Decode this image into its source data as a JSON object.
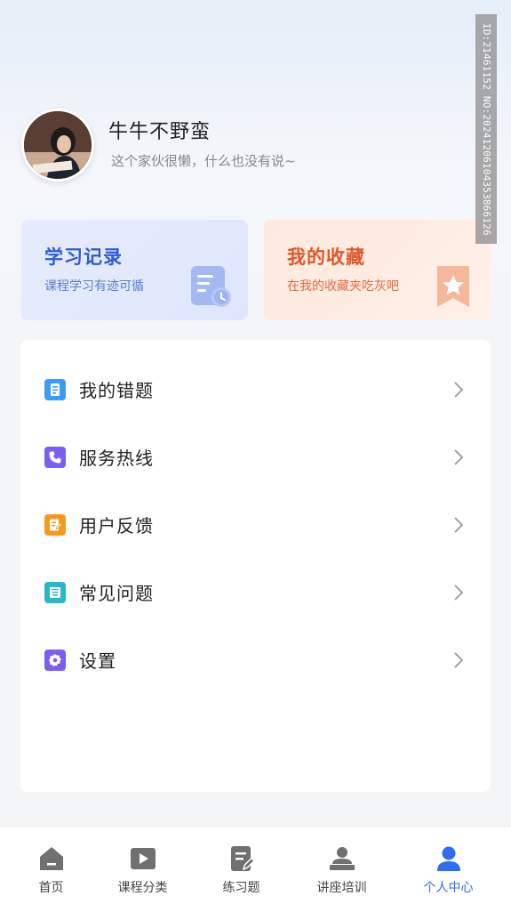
{
  "profile": {
    "username": "牛牛不野蛮",
    "bio": "这个家伙很懒，什么也没有说~"
  },
  "cards": {
    "study": {
      "title": "学习记录",
      "subtitle": "课程学习有迹可循"
    },
    "favorites": {
      "title": "我的收藏",
      "subtitle": "在我的收藏夹吃灰吧"
    }
  },
  "menu": [
    {
      "label": "我的错题",
      "icon": "wrong-questions-icon",
      "color": "#3a9cf5"
    },
    {
      "label": "服务热线",
      "icon": "phone-icon",
      "color": "#7b5ff2"
    },
    {
      "label": "用户反馈",
      "icon": "feedback-icon",
      "color": "#f59a1e"
    },
    {
      "label": "常见问题",
      "icon": "faq-icon",
      "color": "#29b8c9"
    },
    {
      "label": "设置",
      "icon": "gear-icon",
      "color": "#7b5ff2"
    }
  ],
  "tabs": [
    {
      "label": "首页",
      "icon": "home-icon"
    },
    {
      "label": "课程分类",
      "icon": "play-icon"
    },
    {
      "label": "练习题",
      "icon": "exercise-icon"
    },
    {
      "label": "讲座培训",
      "icon": "lecture-icon"
    },
    {
      "label": "个人中心",
      "icon": "user-icon",
      "active": true
    }
  ],
  "watermark": "ID:21461152 NO:20241206104353866126",
  "colors": {
    "accent": "#2f6cf6",
    "study": "#2f5bd7",
    "favorites": "#e2572a"
  }
}
